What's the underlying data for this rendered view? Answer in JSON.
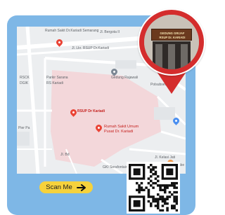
{
  "colors": {
    "card": "#7eb7e6",
    "marker": "#d42d2d",
    "button": "#f6d23c",
    "map_background": "#eceef0",
    "hospital_area": "#f3d7da"
  },
  "map": {
    "labels": {
      "rs_ariadi_semarang": "Rumah Sakit Dr.Kariadi Semarang",
      "jl_bergota": "Jl. Bergota II",
      "jl_lkr": "Jl. Lkr. RSUP Dr.Kariadi",
      "jl_rsup": "Jl. Lkr. RSUP Dr",
      "rscik": "RSCK",
      "dgik": "DGIK",
      "pakuri": "Parkir Sarana",
      "pakuri2": "RS Kariadi",
      "gedung_rajawali": "Gedung Rajawali",
      "polsek": "Polsubsektor",
      "pier": "Pier Pa",
      "rsup_kariadi": "RSUP Dr Kariadi",
      "rumah_sakit_umum": "Rumah Sakit Umum",
      "pusat_dr_kariadi": "Pusat Dr. Kariadi",
      "jl_bd": "Jl. Bd",
      "jl_kelasi": "Jl. Kelasi Jati",
      "jl_bendan": "Jl. Bendan",
      "gki": "GKI Serafontaine",
      "dombe": "Dombe"
    },
    "icons": [
      "hospital-pin-icon",
      "hospital-pin-icon",
      "hospital-pin-icon",
      "location-pin-icon",
      "transit-icon",
      "shopping-pin-icon"
    ]
  },
  "marker": {
    "sign_line1": "GEDUNG GRIJAF",
    "sign_line2": "RSUP Dr. KARIADI"
  },
  "scan_button": {
    "label": "Scan Me",
    "icon": "arrow-right-icon"
  },
  "qr": {
    "icon": "qr-code"
  }
}
